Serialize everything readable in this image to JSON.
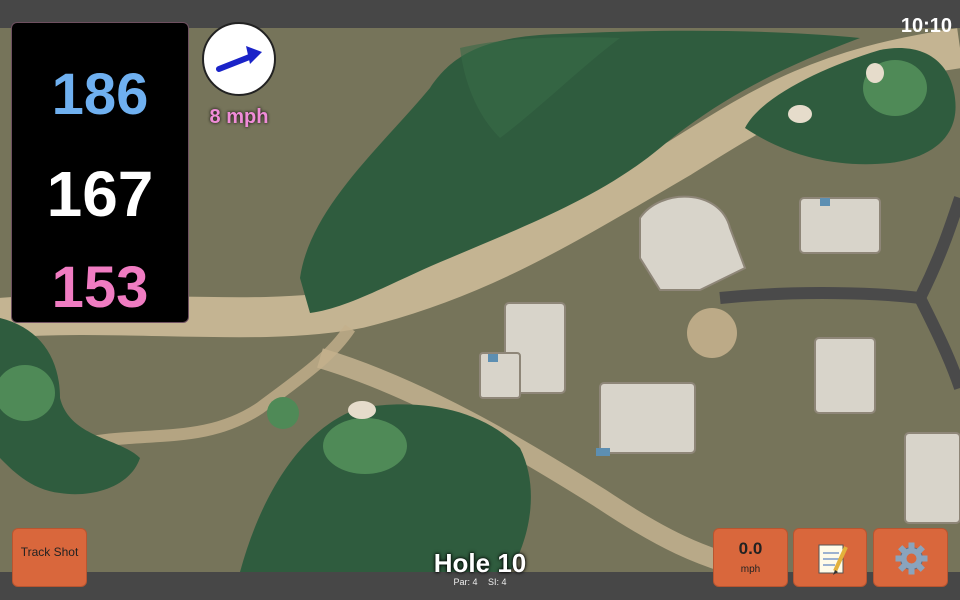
{
  "status": {
    "time": "10:10"
  },
  "distances": {
    "back": "186",
    "middle": "167",
    "front": "153"
  },
  "wind": {
    "speed_label": "8 mph",
    "direction_icon": "arrow-icon"
  },
  "hole": {
    "title": "Hole 10",
    "par": "Par: 4",
    "si": "SI: 4"
  },
  "buttons": {
    "track_shot": "Track Shot",
    "wind_value": "0.0",
    "wind_unit": "mph",
    "notes_icon": "notepad-icon",
    "settings_icon": "gear-icon"
  },
  "colors": {
    "button": "#d9673c",
    "back_distance": "#6fb0f0",
    "middle_distance": "#ffffff",
    "front_distance": "#f07cc2",
    "wind_speed": "#f08cd8"
  }
}
